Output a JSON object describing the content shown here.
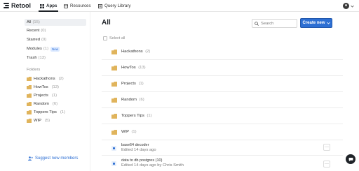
{
  "brand": {
    "name": "Retool"
  },
  "nav": {
    "tabs": [
      {
        "label": "Apps",
        "icon": "apps-grid-icon",
        "active": true
      },
      {
        "label": "Resources",
        "icon": "database-icon",
        "active": false
      },
      {
        "label": "Query Library",
        "icon": "query-library-icon",
        "active": false
      }
    ]
  },
  "sidebar": {
    "filters": [
      {
        "label": "All",
        "count": "(15)",
        "selected": true
      },
      {
        "label": "Recent",
        "count": "(0)"
      },
      {
        "label": "Starred",
        "count": "(0)"
      },
      {
        "label": "Modules",
        "count": "(1)",
        "badge": "New"
      },
      {
        "label": "Trash",
        "count": "(13)"
      }
    ],
    "folders_heading": "Folders",
    "folders": [
      {
        "label": "Hackathons",
        "count": "(2)"
      },
      {
        "label": "HowTos",
        "count": "(13)"
      },
      {
        "label": "Projects",
        "count": "(1)"
      },
      {
        "label": "Random",
        "count": "(6)"
      },
      {
        "label": "Toppers Tips",
        "count": "(1)"
      },
      {
        "label": "WIP",
        "count": "(5)"
      }
    ],
    "suggest_label": "Suggest new members"
  },
  "main": {
    "title": "All",
    "search_placeholder": "Search",
    "create_label": "Create new",
    "select_all_label": "Select all",
    "folder_rows": [
      {
        "name": "Hackathons",
        "count": "(2)"
      },
      {
        "name": "HowTos",
        "count": "(13)"
      },
      {
        "name": "Projects",
        "count": "(1)"
      },
      {
        "name": "Random",
        "count": "(6)"
      },
      {
        "name": "Toppers Tips",
        "count": "(1)"
      },
      {
        "name": "WIP",
        "count": "(1)"
      }
    ],
    "app_rows": [
      {
        "name": "base64 decoder",
        "meta": "Edited 14 days ago"
      },
      {
        "name": "data to db postgres (10)",
        "meta": "Edited 14 days ago by Chris Smith"
      }
    ],
    "more_glyph": "···"
  },
  "colors": {
    "accent": "#2d6fd3",
    "folder": "#e0b45c",
    "text": "#1f2328"
  }
}
